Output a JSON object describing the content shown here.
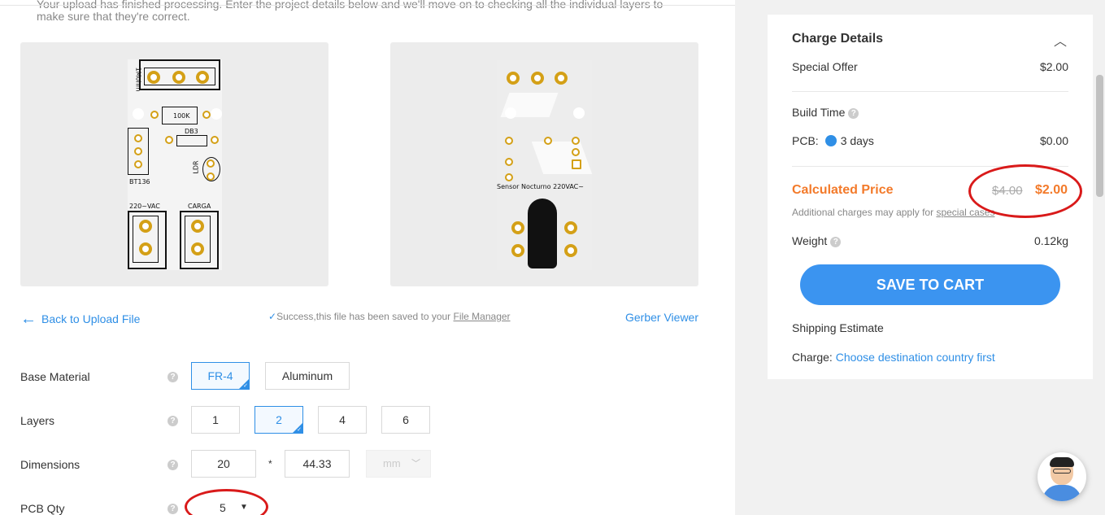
{
  "intro": {
    "line1": "Your upload has finished processing. Enter the project details below and we'll move on to checking all the individual layers to",
    "line2": "make sure that they're correct."
  },
  "top_preview": {
    "silk_1mohm": "1Mohm",
    "silk_100k": "100K",
    "silk_db3": "DB3",
    "silk_ldr": "LDR",
    "silk_bt136": "BT136",
    "silk_220vac": "220~VAC",
    "silk_carga": "CARGA"
  },
  "bottom_preview": {
    "silk_text": "Sensor Nocturno 220VAC~"
  },
  "links": {
    "back": "Back to Upload File",
    "success_prefix": "Success,this file has been saved to your ",
    "file_manager": "File Manager",
    "gerber": "Gerber Viewer"
  },
  "options": {
    "base_material": {
      "label": "Base Material",
      "choices": [
        "FR-4",
        "Aluminum"
      ],
      "selected": "FR-4"
    },
    "layers": {
      "label": "Layers",
      "choices": [
        "1",
        "2",
        "4",
        "6"
      ],
      "selected": "2"
    },
    "dimensions": {
      "label": "Dimensions",
      "width": "20",
      "separator": "*",
      "height": "44.33",
      "unit": "mm"
    },
    "pcb_qty": {
      "label": "PCB Qty",
      "value": "5"
    }
  },
  "charge_details": {
    "title": "Charge Details",
    "special_offer_label": "Special Offer",
    "special_offer_value": "$2.00",
    "build_time_label": "Build Time",
    "pcb_label": "PCB:",
    "pcb_days": "3 days",
    "pcb_value": "$0.00",
    "calculated_label": "Calculated Price",
    "old_price": "$4.00",
    "new_price": "$2.00",
    "note_prefix": "Additional charges may apply for ",
    "note_link": "special cases",
    "weight_label": "Weight",
    "weight_value": "0.12kg",
    "save_button": "SAVE TO CART",
    "shipping_label": "Shipping Estimate",
    "charge_label": "Charge: ",
    "charge_link": "Choose destination country first"
  },
  "colors": {
    "accent_blue": "#2f8fe6",
    "button_blue": "#3b94f0",
    "price_orange": "#f37a2a",
    "annotation_red": "#d91a1a",
    "pad_gold": "#d4a017"
  }
}
